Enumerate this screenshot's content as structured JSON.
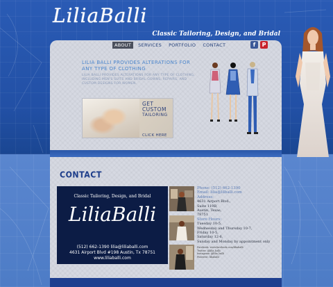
{
  "header": {
    "logo": "LiliaBalli",
    "tagline": "Classic Tailoring, Design, and Bridal"
  },
  "nav": {
    "items": [
      {
        "label": "ABOUT",
        "active": true
      },
      {
        "label": "SERVICES",
        "active": false
      },
      {
        "label": "PORTFOLIO",
        "active": false
      },
      {
        "label": "CONTACT",
        "active": false
      }
    ]
  },
  "social": {
    "facebook": "f",
    "pinterest": "P"
  },
  "intro": {
    "headline": "Lilia Balli provides alterations for any type of clothing",
    "subtext": "Lilia Balli provides alterations for any type of clothing, including men's suits and bridal gowns, repairs, and custom designs for women."
  },
  "promo": {
    "title_line1": "GET",
    "title_line2": "CUSTOM",
    "title_line3": "TAILORING",
    "cta": "CLICK HERE"
  },
  "contact": {
    "heading": "CONTACT",
    "card": {
      "tagline": "Classic Tailoring, Design, and Bridal",
      "logo": "LiliaBalli",
      "line1": "(512) 662-1390 lilia@liliaballi.com",
      "line2": "4631 Airport Blvd #198 Austin, Tx 78751",
      "line3": "www.liliaballi.com"
    },
    "info": {
      "phone": "Phone: (512) 662-1390",
      "email": "Email: lilia@lilballi.com",
      "address_label": "Address:",
      "address1": "4631 Airport Blvd.,",
      "address2": "Suite 119B,",
      "address3": "Austin, Texas,",
      "address4": "78751",
      "hours_label": "Store Hours:",
      "hours1": "Tuesday 10-5,",
      "hours2": "Wednesday and Thursday 10-7,",
      "hours3": "Friday 10-5,",
      "hours4": "Saturday 12-6,",
      "hours5": "Sunday and Monday by appointment only",
      "social1": "Facebook: www.facebook.com/liliaballi",
      "social2": "Twitter: @lilia_balli",
      "social3": "Instagram: @lilia_balli",
      "social4": "Pinterest: liliaballi"
    }
  },
  "colors": {
    "background": "#1f4e9a",
    "panel": "#d6d9e2",
    "accent": "#4c86cc",
    "navy": "#0c1c45"
  }
}
